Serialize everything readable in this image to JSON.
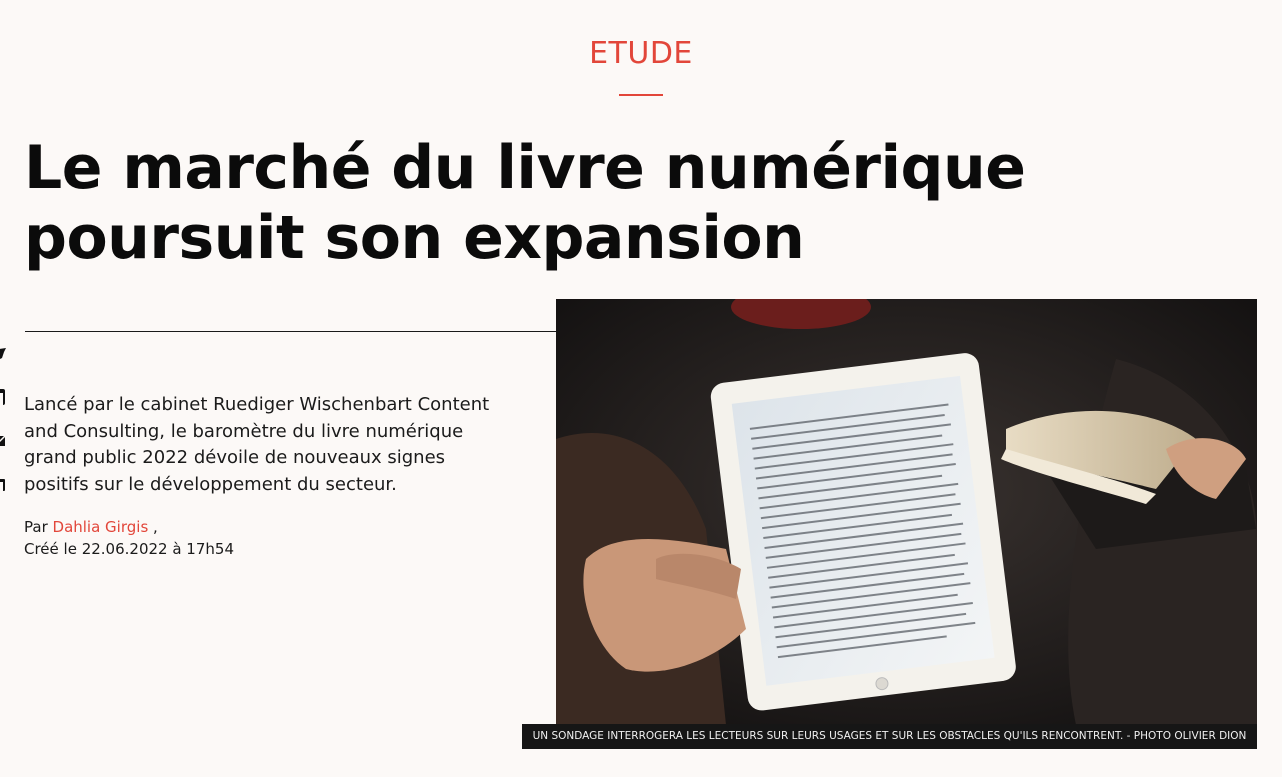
{
  "article": {
    "category": "ETUDE",
    "title": "Le marché du livre numérique poursuit son expansion",
    "lede": "Lancé par le cabinet Ruediger Wischenbart Content and Consulting, le baromètre du livre numérique grand public 2022 dévoile de nouveaux signes positifs sur le développement du secteur.",
    "byline_prefix": "Par",
    "author": "Dahlia Girgis",
    "author_suffix": ",",
    "created": "Créé le 22.06.2022 à 17h54",
    "image_caption": "UN SONDAGE INTERROGERA LES LECTEURS SUR LEURS USAGES ET SUR LES OBSTACLES QU'ILS RENCONTRENT. - PHOTO OLIVIER DION"
  },
  "share": [
    {
      "icon": "twitter-icon"
    },
    {
      "icon": "facebook-icon"
    },
    {
      "icon": "email-icon"
    },
    {
      "icon": "linkedin-icon"
    }
  ],
  "colors": {
    "accent": "#e2463a",
    "background": "#fcf9f7",
    "text": "#0b0b0b",
    "caption_bg": "#161616"
  }
}
